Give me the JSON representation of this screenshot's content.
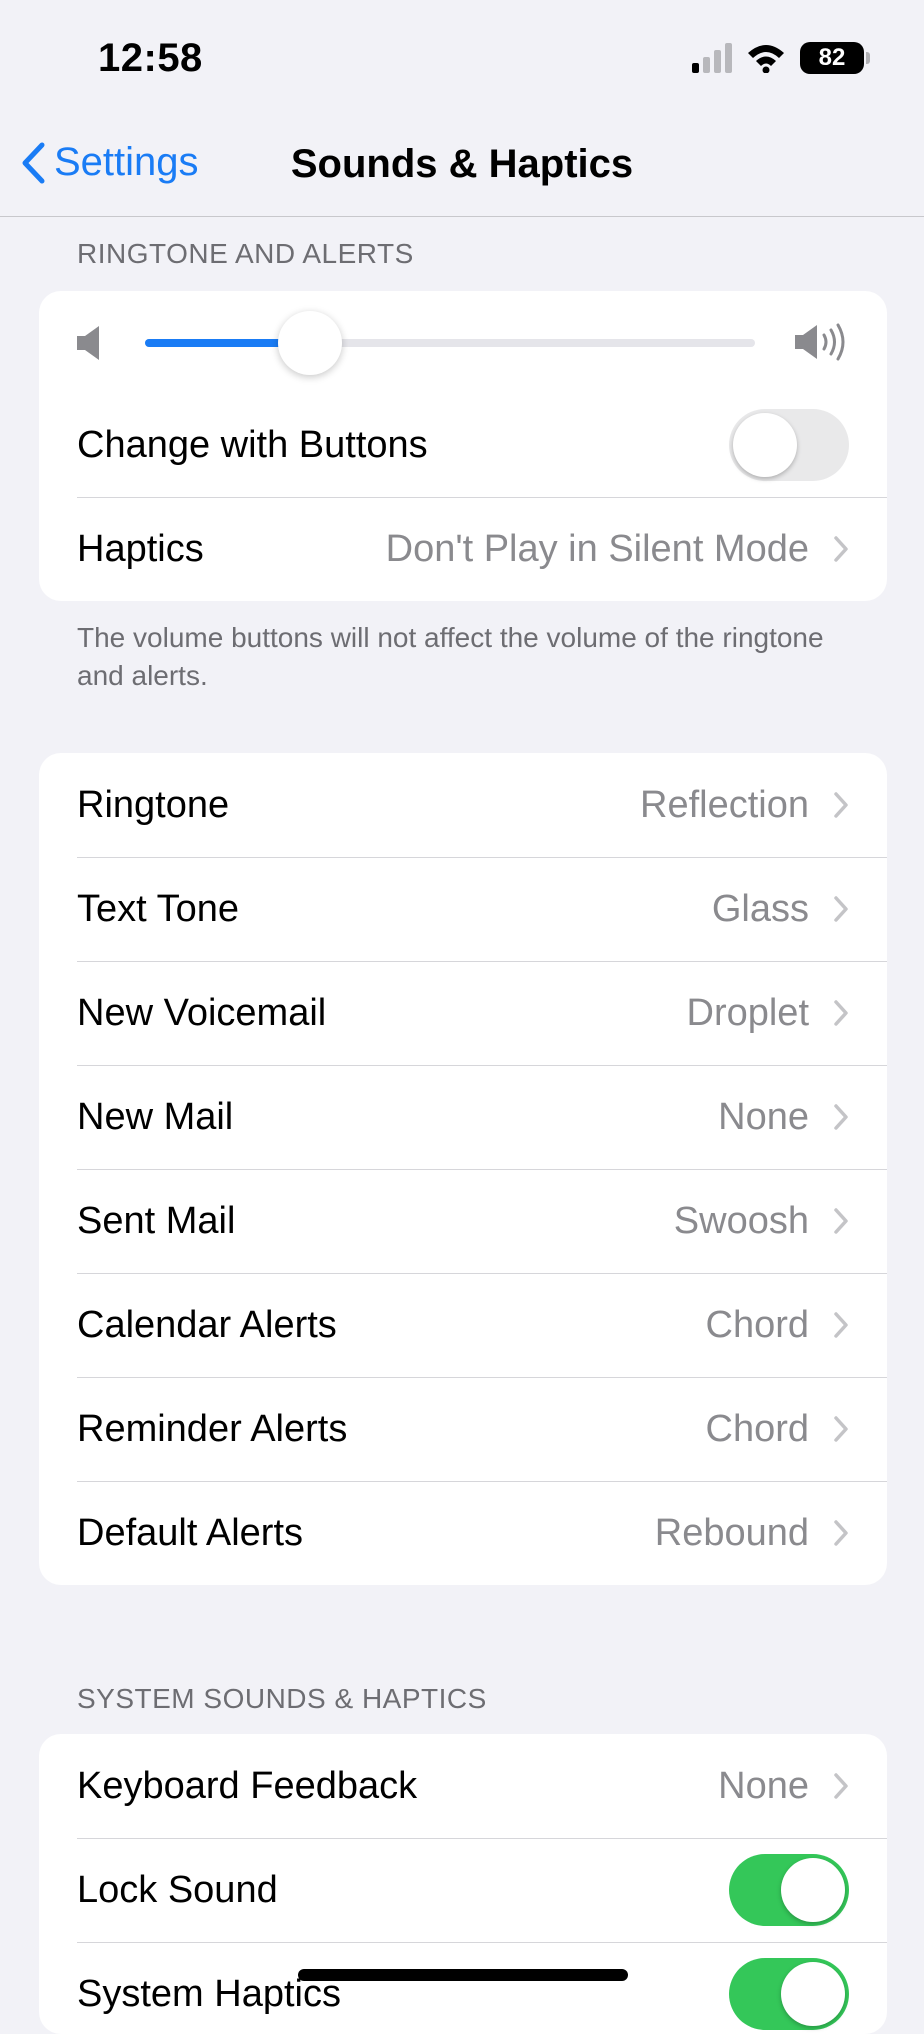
{
  "status_bar": {
    "time": "12:58",
    "battery": "82",
    "signal_icon": "cellular-signal-icon",
    "wifi_icon": "wifi-icon"
  },
  "nav": {
    "back_label": "Settings",
    "title": "Sounds & Haptics"
  },
  "ringtone_section": {
    "header": "RINGTONE AND ALERTS",
    "volume_level": 0.27,
    "change_with_buttons": {
      "label": "Change with Buttons",
      "on": false
    },
    "haptics": {
      "label": "Haptics",
      "value": "Don't Play in Silent Mode"
    },
    "footer": "The volume buttons will not affect the volume of the ringtone and alerts."
  },
  "tones": [
    {
      "label": "Ringtone",
      "value": "Reflection"
    },
    {
      "label": "Text Tone",
      "value": "Glass"
    },
    {
      "label": "New Voicemail",
      "value": "Droplet"
    },
    {
      "label": "New Mail",
      "value": "None"
    },
    {
      "label": "Sent Mail",
      "value": "Swoosh"
    },
    {
      "label": "Calendar Alerts",
      "value": "Chord"
    },
    {
      "label": "Reminder Alerts",
      "value": "Chord"
    },
    {
      "label": "Default Alerts",
      "value": "Rebound"
    }
  ],
  "system_section": {
    "header": "SYSTEM SOUNDS & HAPTICS",
    "keyboard_feedback": {
      "label": "Keyboard Feedback",
      "value": "None"
    },
    "lock_sound": {
      "label": "Lock Sound",
      "on": true
    },
    "system_haptics": {
      "label": "System Haptics",
      "on": true
    }
  },
  "colors": {
    "accent": "#1a7cf5",
    "toggle_on": "#34c759",
    "background": "#f2f2f7"
  }
}
